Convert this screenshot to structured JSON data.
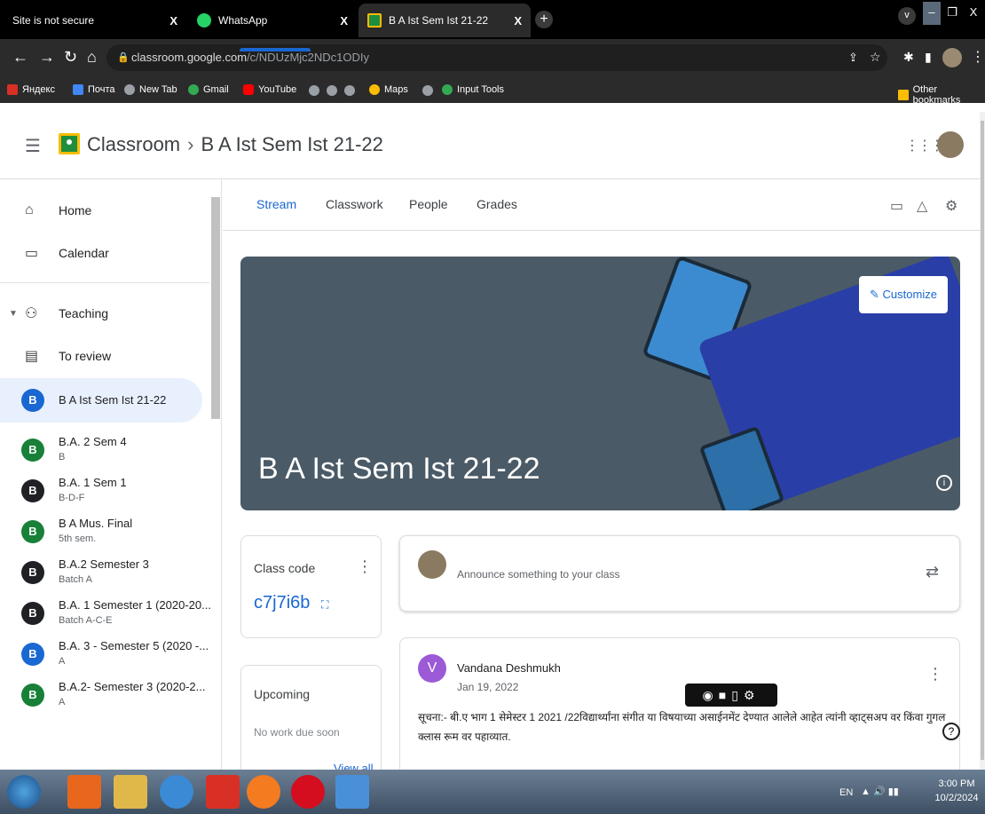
{
  "browser": {
    "tabs": [
      {
        "title": "Site is not secure",
        "close": "X"
      },
      {
        "title": "WhatsApp",
        "close": "X"
      },
      {
        "title": "B A Ist Sem Ist 21-22",
        "close": "X"
      }
    ],
    "new_tab": "+",
    "window": {
      "chevron": "v",
      "minimize": "–",
      "restore": "❐",
      "close": "X"
    },
    "url_host": "classroom.google.com",
    "url_path": "/c/NDUzMjc2NDc1ODIy",
    "bookmarks": [
      {
        "label": "Яндекс",
        "color": "#d93025"
      },
      {
        "label": "Почта",
        "color": "#4285f4"
      },
      {
        "label": "New Tab",
        "color": "#9aa0a6"
      },
      {
        "label": "Gmail",
        "color": "#34a853"
      },
      {
        "label": "YouTube",
        "color": "#ff0000"
      },
      {
        "label": "Maps",
        "color": "#fbbc04"
      },
      {
        "label": "Input Tools",
        "color": "#34a853"
      }
    ],
    "other_bookmarks": "Other bookmarks"
  },
  "header": {
    "app": "Classroom",
    "separator": "›",
    "class_name": "B A Ist Sem Ist 21-22"
  },
  "sidebar": {
    "home": "Home",
    "calendar": "Calendar",
    "teaching": "Teaching",
    "to_review": "To review",
    "classes": [
      {
        "badge": "B",
        "name": "B A Ist Sem Ist 21-22",
        "sub": "",
        "color": "#1967d2",
        "selected": true
      },
      {
        "badge": "B",
        "name": "B.A. 2 Sem 4",
        "sub": "B",
        "color": "#188038"
      },
      {
        "badge": "B",
        "name": "B.A. 1 Sem 1",
        "sub": "B-D-F",
        "color": "#202124"
      },
      {
        "badge": "B",
        "name": "B A Mus. Final",
        "sub": "5th sem.",
        "color": "#188038"
      },
      {
        "badge": "B",
        "name": "B.A.2 Semester 3",
        "sub": "Batch A",
        "color": "#202124"
      },
      {
        "badge": "B",
        "name": "B.A. 1 Semester 1 (2020-20...",
        "sub": "Batch A-C-E",
        "color": "#202124"
      },
      {
        "badge": "B",
        "name": "B.A. 3 - Semester 5 (2020 -...",
        "sub": "A",
        "color": "#1967d2"
      },
      {
        "badge": "B",
        "name": "B.A.2- Semester 3 (2020-2...",
        "sub": "A",
        "color": "#188038"
      }
    ]
  },
  "tabs": {
    "stream": "Stream",
    "classwork": "Classwork",
    "people": "People",
    "grades": "Grades"
  },
  "banner": {
    "title": "B A Ist Sem Ist 21-22",
    "customize": "Customize"
  },
  "class_code": {
    "label": "Class code",
    "value": "c7j7i6b"
  },
  "upcoming": {
    "label": "Upcoming",
    "empty": "No work due soon",
    "view_all": "View all"
  },
  "announce": {
    "placeholder": "Announce something to your class"
  },
  "post": {
    "avatar": "V",
    "author": "Vandana Deshmukh",
    "date": "Jan 19, 2022",
    "body": "सूचना:- बी.ए भाग 1 सेमेस्टर 1 2021 /22विद्यार्थ्यांना संगीत या विषयाच्या असाईनमेंट देण्यात आलेले आहेत त्यांनी व्हाट्सअप वर किंवा गुगल क्लास रूम वर पहाव्यात."
  },
  "taskbar": {
    "lang": "EN",
    "time": "3:00 PM",
    "date": "10/2/2024"
  }
}
